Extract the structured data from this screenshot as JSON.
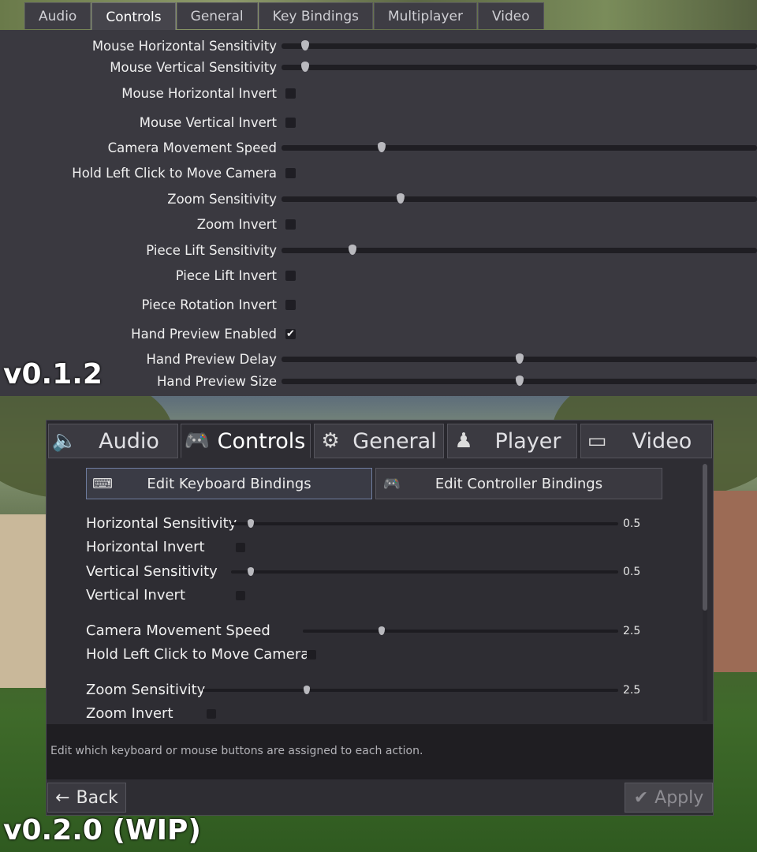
{
  "v1": {
    "tabs": [
      "Audio",
      "Controls",
      "General",
      "Key Bindings",
      "Multiplayer",
      "Video"
    ],
    "active_tab": "Controls",
    "rows": [
      {
        "label": "Mouse Horizontal Sensitivity",
        "type": "slider",
        "level": 0.05
      },
      {
        "label": "Mouse Vertical Sensitivity",
        "type": "slider",
        "level": 0.05
      },
      {
        "label": "Mouse Horizontal Invert",
        "type": "checkbox",
        "checked": false
      },
      {
        "label": "Mouse Vertical Invert",
        "type": "checkbox",
        "checked": false
      },
      {
        "label": "Camera Movement Speed",
        "type": "slider",
        "level": 0.21
      },
      {
        "label": "Hold Left Click to Move Camera",
        "type": "checkbox",
        "checked": false
      },
      {
        "label": "Zoom Sensitivity",
        "type": "slider",
        "level": 0.25
      },
      {
        "label": "Zoom Invert",
        "type": "checkbox",
        "checked": false
      },
      {
        "label": "Piece Lift Sensitivity",
        "type": "slider",
        "level": 0.15
      },
      {
        "label": "Piece Lift Invert",
        "type": "checkbox",
        "checked": false
      },
      {
        "label": "Piece Rotation Invert",
        "type": "checkbox",
        "checked": false
      },
      {
        "label": "Hand Preview Enabled",
        "type": "checkbox",
        "checked": true
      },
      {
        "label": "Hand Preview Delay",
        "type": "slider",
        "level": 0.5
      },
      {
        "label": "Hand Preview Size",
        "type": "slider",
        "level": 0.5
      }
    ],
    "version": "v0.1.2"
  },
  "v2": {
    "tabs": [
      {
        "label": "Audio",
        "icon": "speaker-icon"
      },
      {
        "label": "Controls",
        "icon": "gamepad-icon"
      },
      {
        "label": "General",
        "icon": "gear-icon"
      },
      {
        "label": "Player",
        "icon": "person-icon"
      },
      {
        "label": "Video",
        "icon": "monitor-icon"
      }
    ],
    "active_tab": "Controls",
    "buttons": [
      {
        "label": "Edit Keyboard Bindings",
        "icon": "keyboard-icon"
      },
      {
        "label": "Edit Controller Bindings",
        "icon": "gamepad-icon"
      }
    ],
    "rows": [
      {
        "label": "Horizontal Sensitivity",
        "type": "slider",
        "level": 0.05,
        "value": "0.5"
      },
      {
        "label": "Horizontal Invert",
        "type": "checkbox",
        "checked": false
      },
      {
        "label": "Vertical Sensitivity",
        "type": "slider",
        "level": 0.05,
        "value": "0.5"
      },
      {
        "label": "Vertical Invert",
        "type": "checkbox",
        "checked": false
      },
      {
        "label": "Camera Movement Speed",
        "type": "slider",
        "level": 0.25,
        "value": "2.5"
      },
      {
        "label": "Hold Left Click to Move Camera",
        "type": "checkbox",
        "checked": false
      },
      {
        "label": "Zoom Sensitivity",
        "type": "slider",
        "level": 0.25,
        "value": "2.5"
      },
      {
        "label": "Zoom Invert",
        "type": "checkbox",
        "checked": false
      }
    ],
    "description": "Edit which keyboard or mouse buttons are assigned to each action.",
    "back_label": "Back",
    "apply_label": "Apply",
    "version": "v0.2.0 (WIP)"
  }
}
